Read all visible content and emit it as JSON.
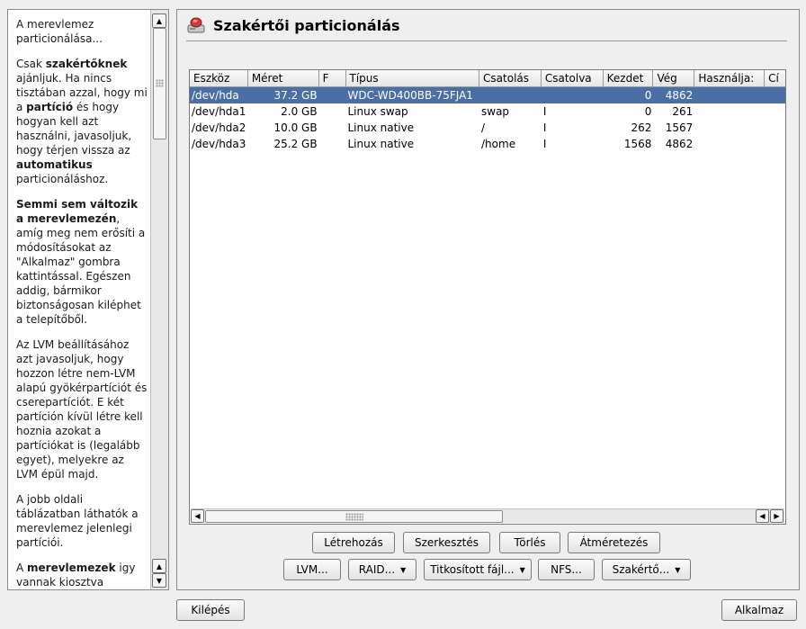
{
  "help": {
    "p1": "A merevlemez particionálása...",
    "p2_a": "Csak ",
    "p2_b": "szakértőknek",
    "p2_c": " ajánljuk. Ha nincs tisztában azzal, hogy mi a ",
    "p2_d": "partíció",
    "p2_e": " és hogy hogyan kell azt használni, javasoljuk, hogy térjen vissza az ",
    "p2_f": "automatikus",
    "p2_g": " particionáláshoz.",
    "p3_a": "Semmi sem változik a merevlemezén",
    "p3_b": ", amíg meg nem erősíti a módosításokat az \"Alkalmaz\" gombra kattintással. Egészen addig, bármikor biztonságosan kiléphet a telepítőből.",
    "p4": "Az LVM beállításához azt javasoljuk, hogy hozzon létre nem-LVM alapú gyökérpartíciót és cserepartíciót. E két partíción kívül létre kell hoznia azokat a partíciókat is (legalább egyet), melyekre az LVM épül majd.",
    "p5": "A jobb oldali táblázatban láthatók a merevlemez jelenlegi partíciói.",
    "p6_a": "A ",
    "p6_b": "merevlemezek",
    "p6_c": " igy vannak kiosztva"
  },
  "title": "Szakértői particionálás",
  "table": {
    "columns": [
      "Eszköz",
      "Méret",
      "F",
      "Típus",
      "Csatolás",
      "Csatolva",
      "Kezdet",
      "Vég",
      "Használja:",
      "Cí"
    ],
    "rows": [
      [
        "/dev/hda",
        "37.2 GB",
        "",
        "WDC-WD400BB-75FJA1",
        "",
        "",
        "0",
        "4862",
        "",
        ""
      ],
      [
        "/dev/hda1",
        "2.0 GB",
        "",
        "Linux swap",
        "swap",
        "I",
        "0",
        "261",
        "",
        ""
      ],
      [
        "/dev/hda2",
        "10.0 GB",
        "",
        "Linux native",
        "/",
        "I",
        "262",
        "1567",
        "",
        ""
      ],
      [
        "/dev/hda3",
        "25.2 GB",
        "",
        "Linux native",
        "/home",
        "I",
        "1568",
        "4862",
        "",
        ""
      ]
    ],
    "selected_row": 0
  },
  "buttons_row1": [
    "Létrehozás",
    "Szerkesztés",
    "Törlés",
    "Átméretezés"
  ],
  "buttons_row2": [
    "LVM...",
    "RAID...",
    "Titkosított fájl...",
    "NFS...",
    "Szakértő..."
  ],
  "bottom": {
    "quit": "Kilépés",
    "apply": "Alkalmaz"
  },
  "colors": {
    "selection": "#4b6fa5",
    "background": "#efefef"
  },
  "icons": {
    "title": "harddisk-icon"
  }
}
